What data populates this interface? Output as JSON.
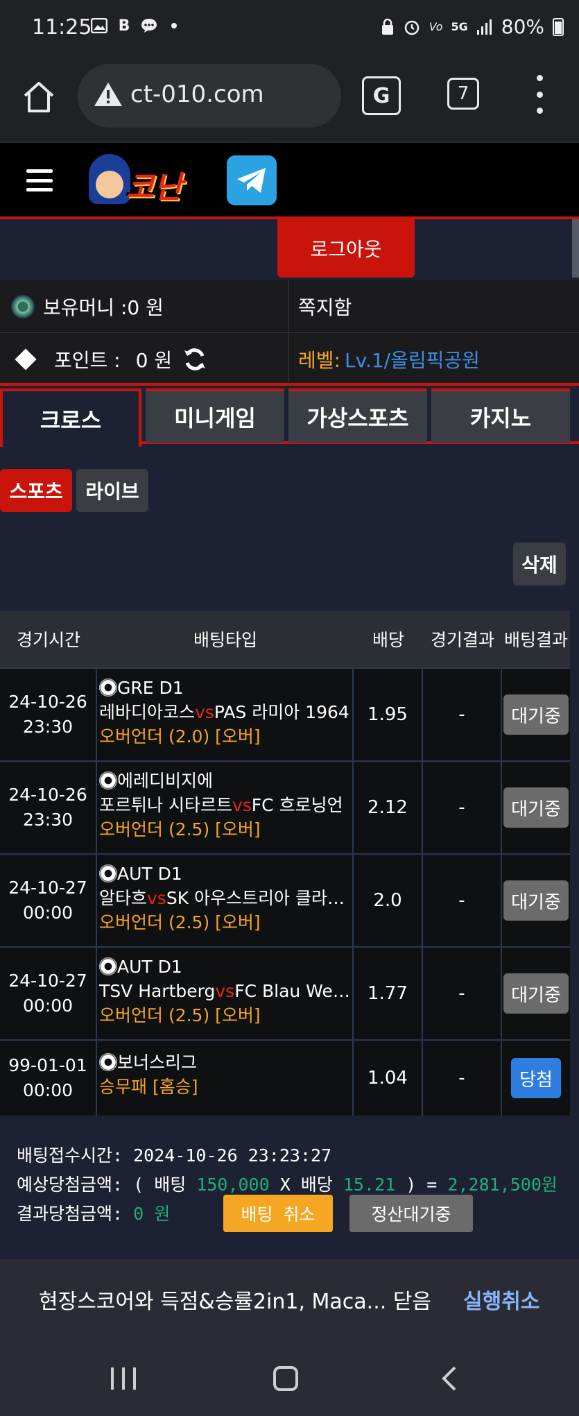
{
  "status_bar": {
    "time": "11:25",
    "battery": "80%",
    "icons": [
      "image-icon",
      "b-icon",
      "chat-icon",
      "dot-icon",
      "lock-icon",
      "alarm-icon",
      "volte-icon",
      "5g-icon",
      "signal-icon",
      "battery-icon"
    ]
  },
  "browser": {
    "url": "ct-010.com",
    "tab_count": "7"
  },
  "site": {
    "logo_text": "코난",
    "logout_label": "로그아웃"
  },
  "account": {
    "money_label": "보유머니 :0 원",
    "message_label": "쪽지함",
    "point_label": "포인트 :",
    "point_value": "0 원",
    "level_label": "레벨:",
    "level_value": "Lv.1/올림픽공원"
  },
  "main_tabs": [
    {
      "label": "크로스",
      "active": true
    },
    {
      "label": "미니게임",
      "active": false
    },
    {
      "label": "가상스포츠",
      "active": false
    },
    {
      "label": "카지노",
      "active": false
    }
  ],
  "sub_tabs": {
    "sports": "스포츠",
    "live": "라이브"
  },
  "delete_label": "삭제",
  "table": {
    "headers": [
      "경기시간",
      "배팅타입",
      "배당",
      "경기결과",
      "배팅결과"
    ],
    "rows": [
      {
        "date": "24-10-26",
        "time": "23:30",
        "league": "GRE D1",
        "home": "레바디아코스",
        "vs": "vs",
        "away": "PAS 라미아 1964",
        "pick": "오버언더 (2.0) [오버]",
        "odds": "1.95",
        "result": "-",
        "status": "대기중",
        "status_type": "wait"
      },
      {
        "date": "24-10-26",
        "time": "23:30",
        "league": "에레디비지에",
        "home": "포르튀나 시타르트",
        "vs": "vs",
        "away": "FC 흐로닝언",
        "pick": "오버언더 (2.5) [오버]",
        "odds": "2.12",
        "result": "-",
        "status": "대기중",
        "status_type": "wait"
      },
      {
        "date": "24-10-27",
        "time": "00:00",
        "league": "AUT D1",
        "home": "알타흐",
        "vs": "vs",
        "away": "SK 아우스트리아 클라…",
        "pick": "오버언더 (2.5) [오버]",
        "odds": "2.0",
        "result": "-",
        "status": "대기중",
        "status_type": "wait"
      },
      {
        "date": "24-10-27",
        "time": "00:00",
        "league": "AUT D1",
        "home": "TSV Hartberg",
        "vs": "vs",
        "away": "FC Blau Weis…",
        "pick": "오버언더 (2.5) [오버]",
        "odds": "1.77",
        "result": "-",
        "status": "대기중",
        "status_type": "wait"
      },
      {
        "date": "99-01-01",
        "time": "00:00",
        "league": "보너스리그",
        "home": "",
        "vs": "",
        "away": "",
        "pick": "승무패 [홈승]",
        "odds": "1.04",
        "result": "-",
        "status": "당첨",
        "status_type": "win"
      }
    ]
  },
  "summary": {
    "receipt_label": "배팅접수시간:",
    "receipt_time": "2024-10-26 23:23:27",
    "expected_label": "예상당첨금액: ( 배팅",
    "stake": "150,000",
    "times_label": "X 배당",
    "total_odds": "15.21",
    "equals_label": ") =",
    "expected_win": "2,281,500원",
    "result_label": "결과당첨금액:",
    "result_win": "0 원",
    "cancel_label": "배팅 취소",
    "pending_label": "정산대기중"
  },
  "snackbar": {
    "text": "현장스코어와 득점&승률2in1, Maca... 닫음",
    "action": "실행취소"
  },
  "colors": {
    "accent_red": "#c9140c",
    "orange": "#f5a623",
    "blue": "#2f7de1",
    "green": "#1fae7a",
    "link_blue": "#8ab4f8"
  }
}
